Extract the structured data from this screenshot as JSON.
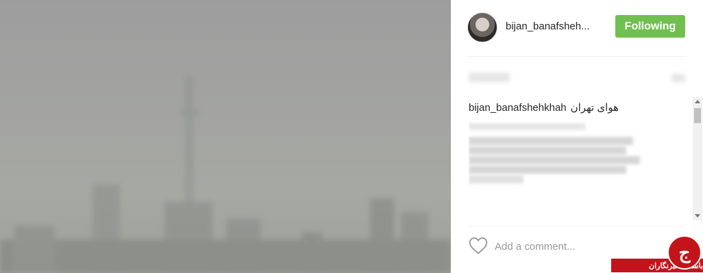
{
  "post": {
    "username": "bijan_banafsheh...",
    "follow_label": "Following",
    "caption_user": "bijan_banafshehkhah",
    "caption_text": "هوای تهران",
    "add_comment_placeholder": "Add a comment..."
  },
  "colors": {
    "follow": "#70c050",
    "logo_red": "#c4141b"
  },
  "logo": {
    "text": "باشگاه خبرنگاران",
    "glyph": "ج"
  },
  "icons": {
    "heart": "heart-icon",
    "avatar": "avatar"
  }
}
